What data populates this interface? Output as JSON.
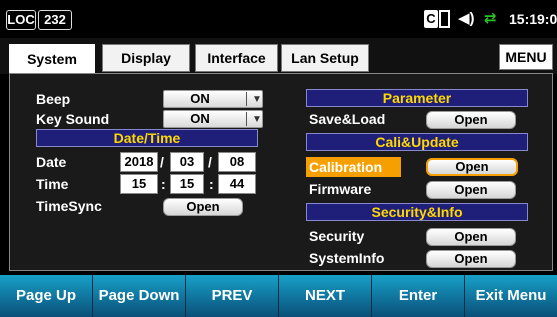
{
  "status": {
    "loc_label": "LOC",
    "loc_number": "232",
    "clock": "15:19:04",
    "icons": [
      "cb-icon",
      "speaker-icon",
      "lan-connection-icon"
    ]
  },
  "tabs": [
    {
      "label": "System",
      "active": true
    },
    {
      "label": "Display",
      "active": false
    },
    {
      "label": "Interface",
      "active": false
    },
    {
      "label": "Lan Setup",
      "active": false
    }
  ],
  "menu_label": "MENU",
  "left": {
    "beep": {
      "label": "Beep",
      "value": "ON"
    },
    "key_sound": {
      "label": "Key Sound",
      "value": "ON"
    },
    "datetime_header": "Date/Time",
    "date": {
      "label": "Date",
      "year": "2018",
      "month": "03",
      "day": "08",
      "sep": "/"
    },
    "time": {
      "label": "Time",
      "hour": "15",
      "minute": "15",
      "second": "44",
      "sep": ":"
    },
    "timesync": {
      "label": "TimeSync",
      "button": "Open"
    }
  },
  "right": {
    "parameter_header": "Parameter",
    "save_load": {
      "label": "Save&Load",
      "button": "Open"
    },
    "cali_header": "Cali&Update",
    "calibration": {
      "label": "Calibration",
      "button": "Open"
    },
    "firmware": {
      "label": "Firmware",
      "button": "Open"
    },
    "security_header": "Security&Info",
    "security": {
      "label": "Security",
      "button": "Open"
    },
    "systeminfo": {
      "label": "SystemInfo",
      "button": "Open"
    }
  },
  "softkeys": [
    "Page Up",
    "Page Down",
    "PREV",
    "NEXT",
    "Enter",
    "Exit Menu"
  ],
  "colors": {
    "header_bg": "#1f1f7a",
    "header_text": "#ffd800",
    "highlight": "#f5a000",
    "softkey": "#17a0c8",
    "lan_icon": "#29c229"
  }
}
